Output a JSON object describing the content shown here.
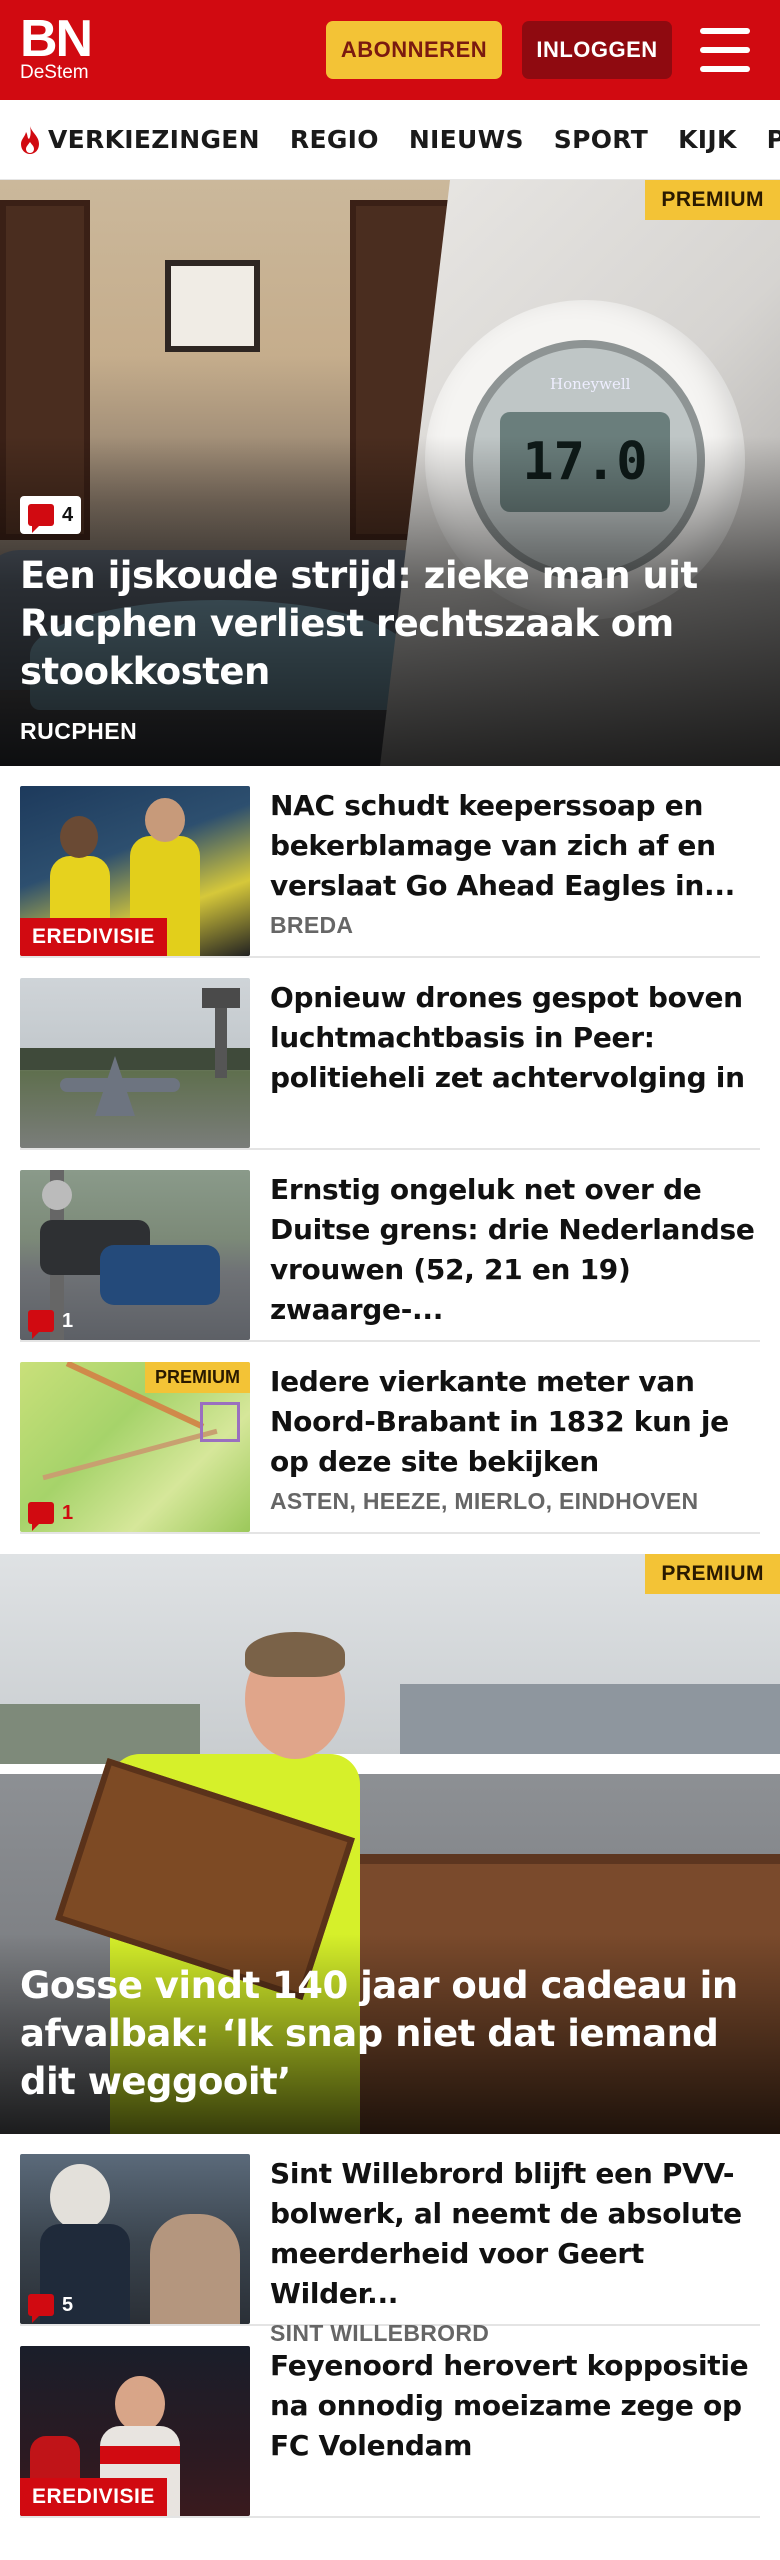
{
  "header": {
    "logo_main": "BN",
    "logo_sub": "DeStem",
    "subscribe_label": "ABONNEREN",
    "login_label": "INLOGGEN",
    "brand_color": "#d10a11"
  },
  "nav": {
    "items": [
      {
        "label": "VERKIEZINGEN",
        "icon": "flame-icon"
      },
      {
        "label": "REGIO"
      },
      {
        "label": "NIEUWS"
      },
      {
        "label": "SPORT"
      },
      {
        "label": "KIJK"
      },
      {
        "label": "PODC"
      }
    ]
  },
  "hero1": {
    "premium": "PREMIUM",
    "comments": "4",
    "thermostat_brand": "Honeywell",
    "thermostat_reading": "17.0",
    "title": "Een ijskoude strijd: zieke man uit Rucphen verliest rechtszaak om stookkosten",
    "place": "RUCPHEN"
  },
  "articles": [
    {
      "title": "NAC schudt keeperssoap en bekerblamage van zich af en verslaat Go Ahead Eagles in...",
      "place": "BREDA",
      "category": "EREDIVISIE"
    },
    {
      "title": "Opnieuw drones gespot boven luchtmachtbasis in Peer: politieheli zet achtervolging in"
    },
    {
      "title": "Ernstig ongeluk net over de Duitse grens: drie Nederlandse vrouwen (52, 21 en 19) zwaarge-...",
      "comments": "1"
    },
    {
      "title": "Iedere vierkante meter van Noord-Brabant in 1832 kun je op deze site bekijken",
      "place": "ASTEN, HEEZE, MIERLO, EINDHOVEN",
      "comments": "1",
      "premium": "PREMIUM"
    }
  ],
  "hero2": {
    "premium": "PREMIUM",
    "title": "Gosse vindt 140 jaar oud cadeau in afvalbak: ‘Ik snap niet dat iemand dit weggooit’"
  },
  "articles2": [
    {
      "title": "Sint Willebrord blijft een PVV-bolwerk, al neemt de absolute meerderheid voor Geert Wilder...",
      "place": "SINT WILLEBRORD",
      "comments": "5"
    },
    {
      "title": "Feyenoord herovert koppositie na onnodig moeizame zege op FC Volendam",
      "category": "EREDIVISIE"
    }
  ]
}
